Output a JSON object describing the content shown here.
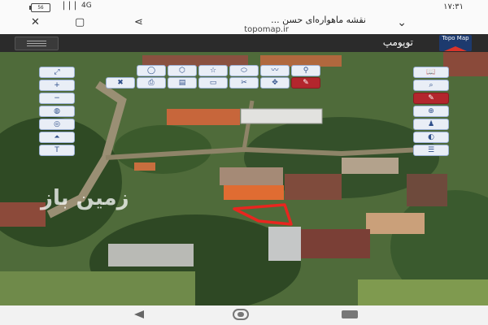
{
  "status_bar": {
    "battery": "56",
    "signal": "▕▕▕",
    "network": "4G",
    "time": "۱۷:۳۱"
  },
  "browser": {
    "page_title": "نقشه ماهواره‌ای حسن ...",
    "url": "topomap.ir"
  },
  "app": {
    "title": "توپومپ",
    "logo_text": "Topo Map",
    "watermark": "زمین باز"
  },
  "toolbars": {
    "left_column": [
      "zoom-extent-icon",
      "zoom-in-icon",
      "zoom-out-icon",
      "globe-icon",
      "layers-icon",
      "terrain-icon",
      "text-tool-icon"
    ],
    "top_row1": [
      "circle-draw-icon",
      "polygon-draw-icon",
      "star-draw-icon",
      "ellipse-draw-icon",
      "polyline-draw-icon",
      "marker-icon"
    ],
    "top_row2": [
      "delete-icon",
      "print-icon",
      "export-icon",
      "folder-icon",
      "measure-icon",
      "move-icon",
      "edit-pen-icon"
    ],
    "right_column": [
      "book-icon",
      "search-icon",
      "pencil-icon",
      "grid-globe-icon",
      "person-locate-icon",
      "compass-icon",
      "settings-sliders-icon"
    ],
    "labels": {
      "text_tool": "T",
      "delete": "✖",
      "print": "⎙",
      "plus": "+",
      "minus": "−"
    }
  },
  "colors": {
    "toolbar_bg": "#e9eef6",
    "toolbar_border": "#9cb2d6",
    "active_tool": "#b3262d",
    "marker_outline": "#e8261f",
    "header_bg": "#2b2b2b"
  }
}
